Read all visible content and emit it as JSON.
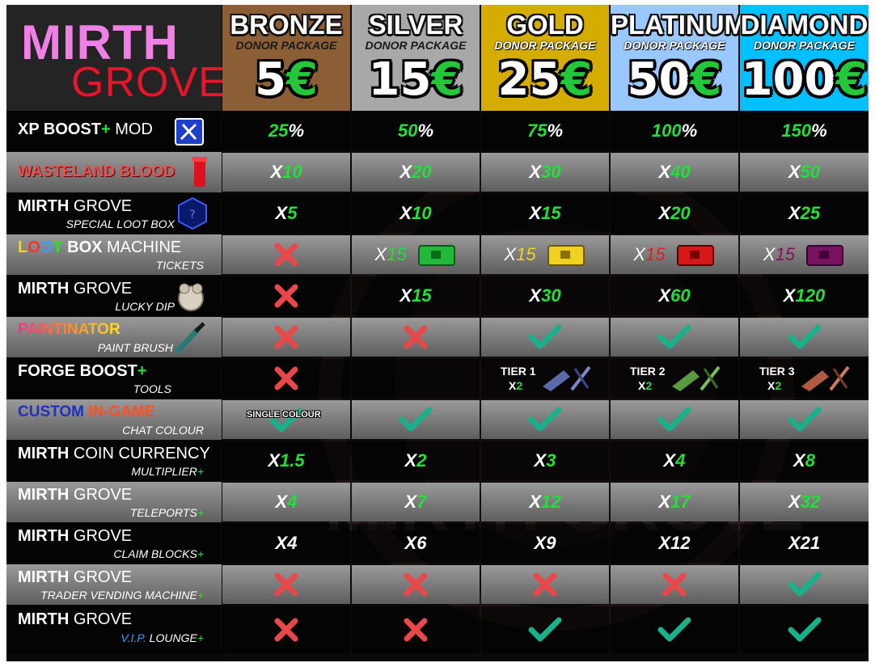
{
  "logo": {
    "line1": "MIRTH",
    "line2": "GROVE"
  },
  "tiers": [
    {
      "name": "BRONZE",
      "sub": "DONOR PACKAGE",
      "price": "5",
      "currency": "€",
      "color": "#8b5e35"
    },
    {
      "name": "SILVER",
      "sub": "DONOR PACKAGE",
      "price": "15",
      "currency": "€",
      "color": "#a8a8a8"
    },
    {
      "name": "GOLD",
      "sub": "DONOR PACKAGE",
      "price": "25",
      "currency": "€",
      "color": "#d4ad00"
    },
    {
      "name": "PLATINUM",
      "sub": "DONOR PACKAGE",
      "price": "50",
      "currency": "€",
      "color": "#98c8ff"
    },
    {
      "name": "DIAMOND",
      "sub": "DONOR PACKAGE",
      "price": "100",
      "currency": "€",
      "color": "#00c0ff"
    }
  ],
  "rows": {
    "xp": {
      "a": "XP BOOST",
      "b": "+",
      "c": " MOD",
      "icon": "wrench-screwdriver-icon",
      "cells": [
        [
          "25",
          "%"
        ],
        [
          "50",
          "%"
        ],
        [
          "75",
          "%"
        ],
        [
          "100",
          "%"
        ],
        [
          "150",
          "%"
        ]
      ]
    },
    "blood": {
      "title": "WASTELAND BLOOD",
      "icon": "blood-vial-icon",
      "cells": [
        [
          "X",
          "10"
        ],
        [
          "X",
          "20"
        ],
        [
          "X",
          "30"
        ],
        [
          "X",
          "40"
        ],
        [
          "X",
          "50"
        ]
      ]
    },
    "lootbox": {
      "a": "MIRTH",
      "b": " GROVE",
      "sub": "SPECIAL LOOT BOX",
      "icon": "loot-box-icon",
      "cells": [
        [
          "X",
          "5"
        ],
        [
          "X",
          "10"
        ],
        [
          "X",
          "15"
        ],
        [
          "X",
          "20"
        ],
        [
          "X",
          "25"
        ]
      ]
    },
    "machine": {
      "l1": "L",
      "l2": "O",
      "l3": "O",
      "l4": "T",
      "b": " BOX",
      "c": " MACHINE",
      "sub": "TICKETS",
      "cells": [
        {
          "type": "cross"
        },
        {
          "x": "X",
          "n": "15",
          "color": "#22e03a"
        },
        {
          "x": "X",
          "n": "15",
          "color": "#f0d020"
        },
        {
          "x": "X",
          "n": "15",
          "color": "#e02020"
        },
        {
          "x": "X",
          "n": "15",
          "color": "#8a1060"
        }
      ]
    },
    "dip": {
      "a": "MIRTH",
      "b": " GROVE",
      "sub": "LUCKY DIP",
      "icon": "lucky-dip-icon",
      "cells": [
        {
          "type": "cross"
        },
        [
          "X",
          "15"
        ],
        [
          "X",
          "30"
        ],
        [
          "X",
          "60"
        ],
        [
          "X",
          "120"
        ]
      ]
    },
    "paint": {
      "title": "PAINTINATOR",
      "sub": "PAINT BRUSH",
      "icon": "paint-brush-icon",
      "cells": [
        "cross",
        "cross",
        "check",
        "check",
        "check"
      ]
    },
    "forge": {
      "a": "FORGE BOOST",
      "b": "+",
      "sub": "TOOLS",
      "cells": [
        {
          "type": "cross"
        },
        {
          "type": "empty"
        },
        {
          "tier": "TIER 1",
          "x": "X",
          "n": "2",
          "color": "#5a6aa8"
        },
        {
          "tier": "TIER 2",
          "x": "X",
          "n": "2",
          "color": "#5a9a40"
        },
        {
          "tier": "TIER 3",
          "x": "X",
          "n": "2",
          "color": "#b05a40"
        }
      ]
    },
    "chat": {
      "a": "CUSTOM",
      "b": " IN-GAME",
      "sub": "CHAT COLOUR",
      "single": "SINGLE COLOUR",
      "cells": [
        "single",
        "check",
        "check",
        "check",
        "check"
      ]
    },
    "coin": {
      "a": "MIRTH",
      "b": " COIN CURRENCY",
      "sub": "MULTIPLIER",
      "plus": "+",
      "cells": [
        [
          "X",
          "1.5"
        ],
        [
          "X",
          "2"
        ],
        [
          "X",
          "3"
        ],
        [
          "X",
          "4"
        ],
        [
          "X",
          "8"
        ]
      ]
    },
    "tele": {
      "a": "MIRTH",
      "b": " GROVE",
      "sub": "TELEPORTS",
      "plus": "+",
      "cells": [
        [
          "X",
          "4"
        ],
        [
          "X",
          "7"
        ],
        [
          "X",
          "12"
        ],
        [
          "X",
          "17"
        ],
        [
          "X",
          "32"
        ]
      ]
    },
    "claim": {
      "a": "MIRTH",
      "b": " GROVE",
      "sub": "CLAIM BLOCKS",
      "plus": "+",
      "cells": [
        [
          "X",
          "4"
        ],
        [
          "X",
          "6"
        ],
        [
          "X",
          "9"
        ],
        [
          "X",
          "12"
        ],
        [
          "X",
          "21"
        ]
      ]
    },
    "vend": {
      "a": "MIRTH",
      "b": " GROVE",
      "sub": "TRADER VENDING MACHINE",
      "plus": "+",
      "cells": [
        "cross",
        "cross",
        "cross",
        "cross",
        "check"
      ]
    },
    "vip": {
      "a": "MIRTH",
      "b": " GROVE",
      "sub1": "V.I.P.",
      "sub2": " LOUNGE",
      "plus": "+",
      "cells": [
        "cross",
        "cross",
        "check",
        "check",
        "check"
      ]
    }
  },
  "watermark": "MIRTH GROVE",
  "colors": {
    "green": "#22e03a",
    "cross": "#e8484a",
    "check": "#19b08a"
  }
}
